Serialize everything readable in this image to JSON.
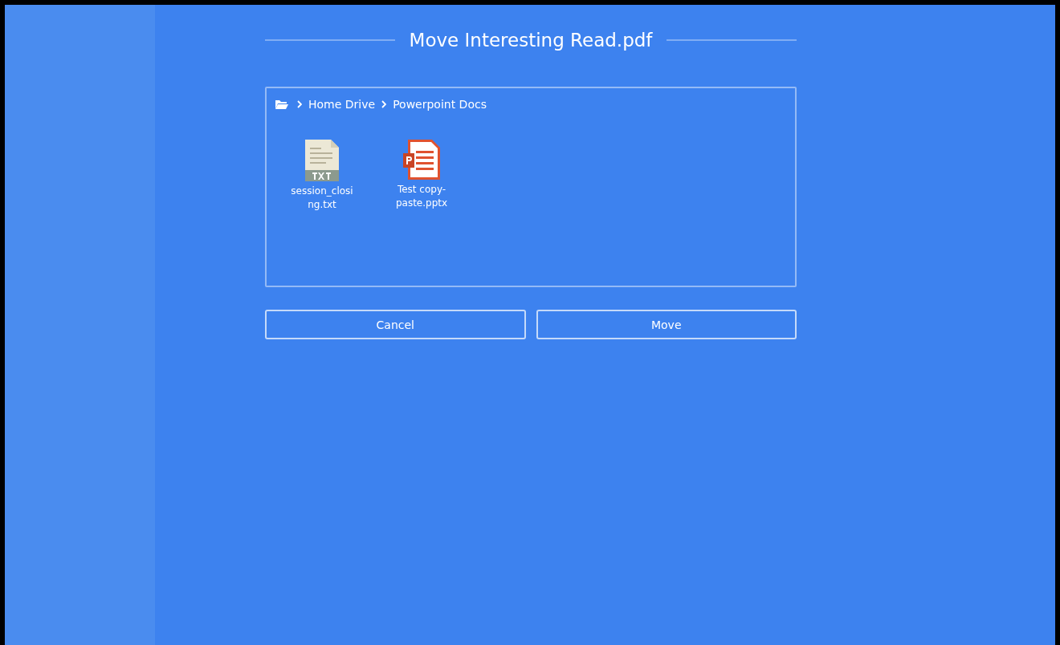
{
  "dialog": {
    "title": "Move Interesting Read.pdf",
    "breadcrumb": [
      "Home Drive",
      "Powerpoint Docs"
    ],
    "files": [
      {
        "name": "session_closing.txt",
        "kind": "txt"
      },
      {
        "name": "Test copy-paste.pptx",
        "kind": "pptx"
      }
    ],
    "buttons": [
      "Cancel",
      "Move"
    ]
  }
}
